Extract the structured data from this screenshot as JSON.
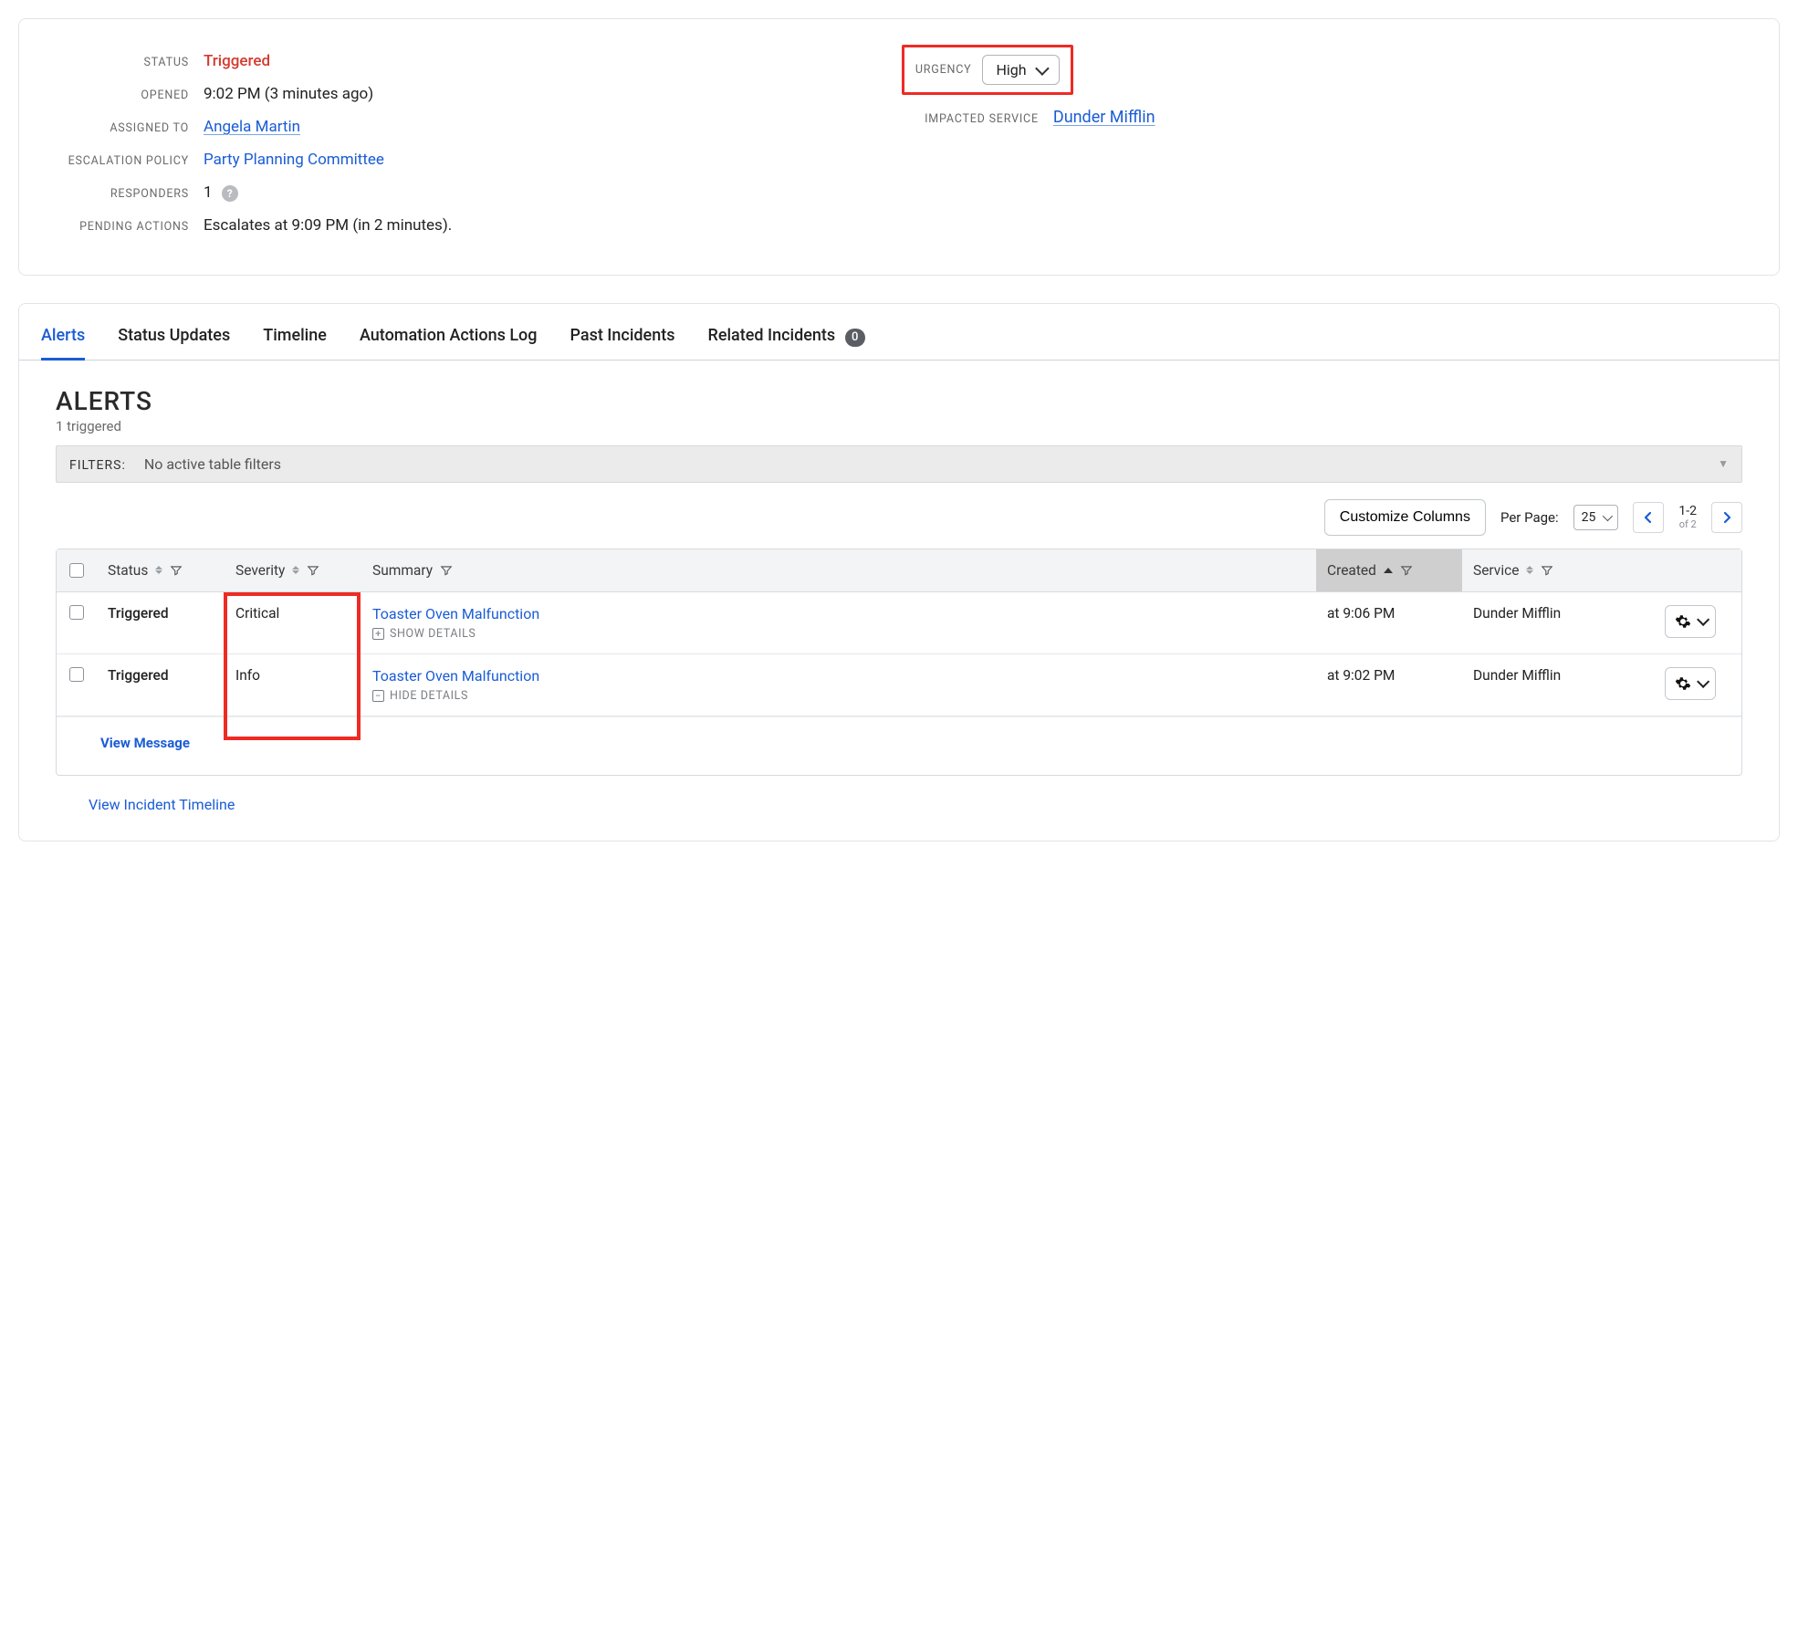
{
  "incident": {
    "labels": {
      "status": "STATUS",
      "opened": "OPENED",
      "assigned_to": "ASSIGNED TO",
      "escalation_policy": "ESCALATION POLICY",
      "responders": "RESPONDERS",
      "pending_actions": "PENDING ACTIONS",
      "urgency": "URGENCY",
      "impacted_service": "IMPACTED SERVICE"
    },
    "status": "Triggered",
    "opened": "9:02 PM (3 minutes ago)",
    "assigned_to": "Angela Martin",
    "escalation_policy": "Party Planning Committee",
    "responders_count": "1",
    "pending_actions": "Escalates at 9:09 PM (in 2 minutes).",
    "urgency": "High",
    "impacted_service": "Dunder Mifflin"
  },
  "tabs": [
    {
      "label": "Alerts",
      "active": true
    },
    {
      "label": "Status Updates"
    },
    {
      "label": "Timeline"
    },
    {
      "label": "Automation Actions Log"
    },
    {
      "label": "Past Incidents"
    },
    {
      "label": "Related Incidents",
      "count": "0"
    }
  ],
  "alerts": {
    "heading": "ALERTS",
    "sub": "1 triggered",
    "filters_label": "FILTERS:",
    "filters_none": "No active table filters",
    "customize_columns": "Customize Columns",
    "per_page_label": "Per Page:",
    "per_page_value": "25",
    "pagination_range": "1-2",
    "pagination_total": "of 2",
    "columns": {
      "status": "Status",
      "severity": "Severity",
      "summary": "Summary",
      "created": "Created",
      "service": "Service"
    },
    "rows": [
      {
        "status": "Triggered",
        "severity": "Critical",
        "summary": "Toaster Oven Malfunction",
        "details_toggle": "SHOW DETAILS",
        "expanded_icon": "plus",
        "created": "at 9:06 PM",
        "service": "Dunder Mifflin"
      },
      {
        "status": "Triggered",
        "severity": "Info",
        "summary": "Toaster Oven Malfunction",
        "details_toggle": "HIDE DETAILS",
        "expanded_icon": "minus",
        "created": "at 9:02 PM",
        "service": "Dunder Mifflin"
      }
    ],
    "view_message": "View Message",
    "view_timeline": "View Incident Timeline"
  }
}
